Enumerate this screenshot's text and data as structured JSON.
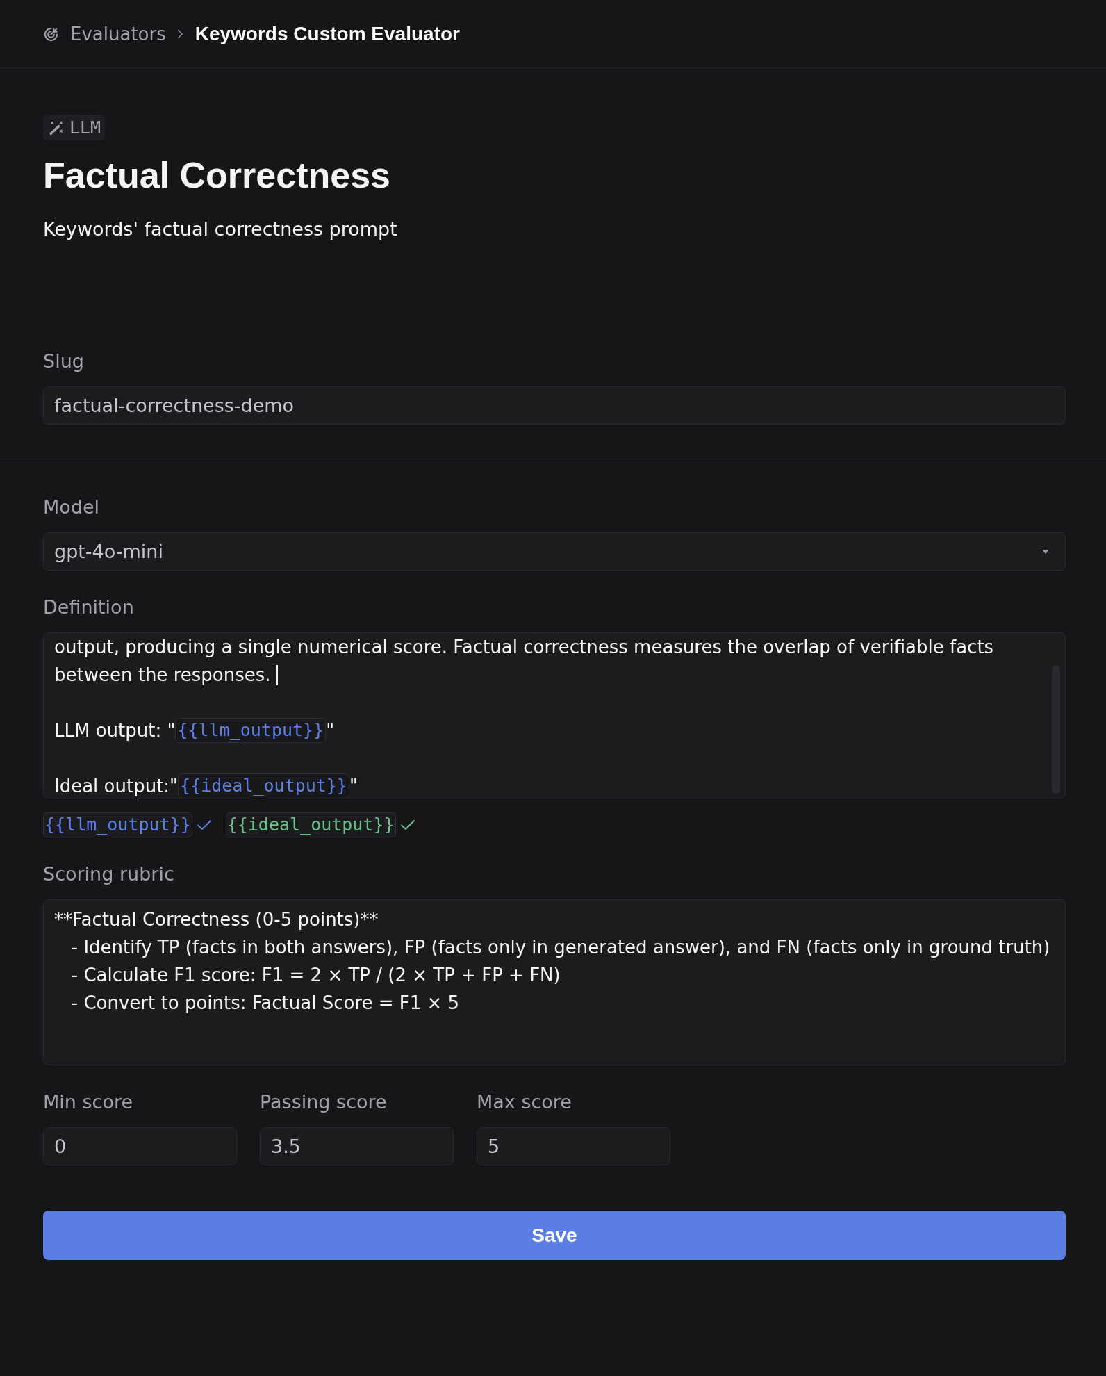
{
  "breadcrumb": [
    {
      "label": "Evaluators",
      "current": false
    },
    {
      "label": "Keywords Custom Evaluator",
      "current": true
    }
  ],
  "evaluator": {
    "type": "LLM",
    "title": "Factual Correctness",
    "description": "Keywords' factual correctness prompt"
  },
  "slug": {
    "label": "Slug",
    "value": "factual-correctness-demo"
  },
  "model": {
    "label": "Model",
    "value": "gpt-4o-mini"
  },
  "definition": {
    "label": "Definition",
    "paragraphs": [
      {
        "lines": [
          {
            "segments": [
              {
                "kind": "text",
                "text": "output, producing a single numerical score. Factual correctness measures the overlap of verifiable facts"
              }
            ],
            "cursor": false
          },
          {
            "segments": [
              {
                "kind": "text",
                "text": "between the responses."
              }
            ],
            "cursor": true
          }
        ]
      },
      {
        "lines": [
          {
            "segments": [
              {
                "kind": "text",
                "text": "LLM output: \""
              },
              {
                "kind": "variable",
                "text": "{{llm_output}}"
              },
              {
                "kind": "text",
                "text": "\""
              }
            ],
            "cursor": false
          }
        ]
      },
      {
        "lines": [
          {
            "segments": [
              {
                "kind": "text",
                "text": "Ideal output:\""
              },
              {
                "kind": "variable",
                "text": "{{ideal_output}}"
              },
              {
                "kind": "text",
                "text": "\""
              }
            ],
            "cursor": false
          }
        ]
      }
    ],
    "variables": [
      {
        "name": "{{llm_output}}",
        "color": "#5b7fe6",
        "valid": true
      },
      {
        "name": "{{ideal_output}}",
        "color": "#6cc08a",
        "valid": true
      }
    ]
  },
  "scoring_rubric": {
    "label": "Scoring rubric",
    "lines": [
      "**Factual Correctness (0-5 points)**",
      "   - Identify TP (facts in both answers), FP (facts only in generated answer), and FN (facts only in ground truth)",
      "   - Calculate F1 score: F1 = 2 × TP / (2 × TP + FP + FN)",
      "   - Convert to points: Factual Score = F1 × 5"
    ]
  },
  "scores": [
    {
      "label": "Min score",
      "value": "0"
    },
    {
      "label": "Passing score",
      "value": "3.5"
    },
    {
      "label": "Max score",
      "value": "5"
    }
  ],
  "save_button": {
    "label": "Save"
  }
}
